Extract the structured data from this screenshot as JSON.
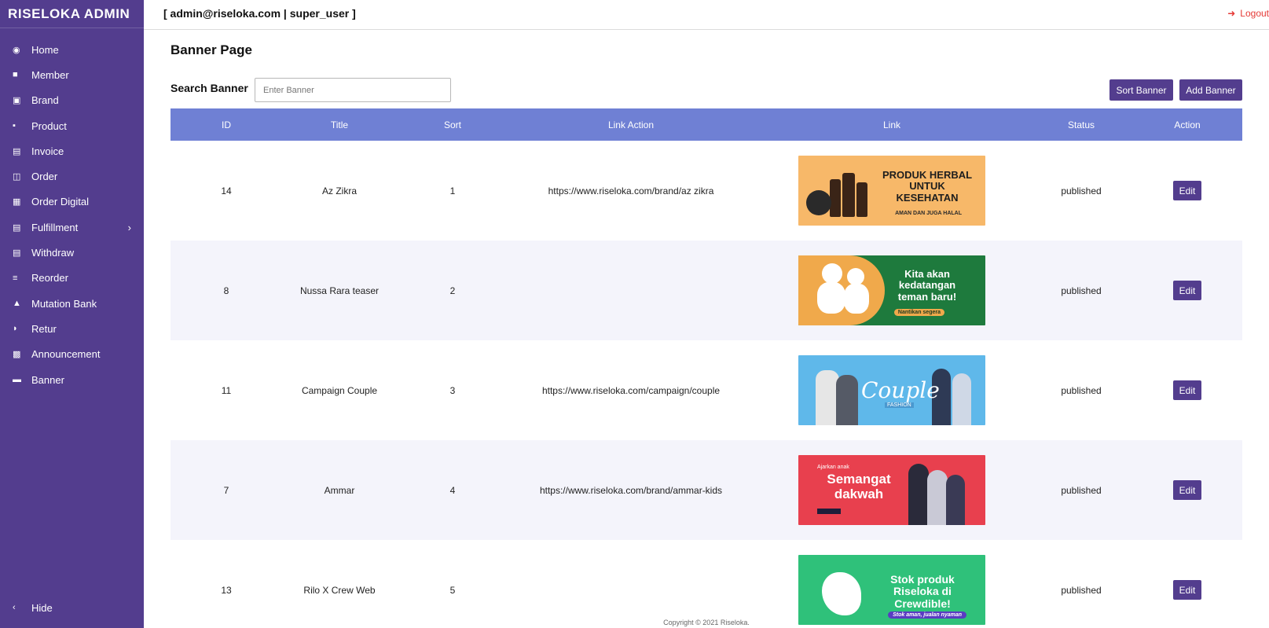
{
  "app": {
    "title": "RISELOKA ADMIN"
  },
  "topbar": {
    "user_info": "[ admin@riseloka.com | super_user ]",
    "logout_label": "Logout"
  },
  "sidebar": {
    "items": [
      {
        "label": "Home",
        "icon": "dashboard-icon"
      },
      {
        "label": "Member",
        "icon": "user-icon"
      },
      {
        "label": "Brand",
        "icon": "brand-icon"
      },
      {
        "label": "Product",
        "icon": "product-icon"
      },
      {
        "label": "Invoice",
        "icon": "invoice-icon"
      },
      {
        "label": "Order",
        "icon": "order-icon"
      },
      {
        "label": "Order Digital",
        "icon": "calendar-icon"
      },
      {
        "label": "Fulfillment",
        "icon": "file-icon",
        "has_submenu": true
      },
      {
        "label": "Withdraw",
        "icon": "file-icon"
      },
      {
        "label": "Reorder",
        "icon": "list-icon"
      },
      {
        "label": "Mutation Bank",
        "icon": "bank-icon"
      },
      {
        "label": "Retur",
        "icon": "return-icon"
      },
      {
        "label": "Announcement",
        "icon": "announcement-icon"
      },
      {
        "label": "Banner",
        "icon": "banner-icon"
      }
    ],
    "hide_label": "Hide"
  },
  "page": {
    "title": "Banner Page",
    "search_label": "Search Banner",
    "search_placeholder": "Enter Banner",
    "sort_button": "Sort Banner",
    "add_button": "Add Banner"
  },
  "table": {
    "columns": [
      "ID",
      "Title",
      "Sort",
      "Link Action",
      "Link",
      "Status",
      "Action"
    ],
    "rows": [
      {
        "id": "14",
        "title": "Az Zikra",
        "sort": "1",
        "link_action": "https://www.riseloka.com/brand/az zikra",
        "status": "published",
        "action": "Edit",
        "banner": {
          "headline": "PRODUK HERBAL UNTUK KESEHATAN",
          "sub": "AMAN DAN JUGA HALAL"
        }
      },
      {
        "id": "8",
        "title": "Nussa Rara teaser",
        "sort": "2",
        "link_action": "",
        "status": "published",
        "action": "Edit",
        "banner": {
          "headline": "Kita akan kedatangan teman baru!",
          "sub": "Nantikan segera"
        }
      },
      {
        "id": "11",
        "title": "Campaign Couple",
        "sort": "3",
        "link_action": "https://www.riseloka.com/campaign/couple",
        "status": "published",
        "action": "Edit",
        "banner": {
          "headline": "Couple",
          "sub": "FASHION"
        }
      },
      {
        "id": "7",
        "title": "Ammar",
        "sort": "4",
        "link_action": "https://www.riseloka.com/brand/ammar-kids",
        "status": "published",
        "action": "Edit",
        "banner": {
          "headline": "Semangat dakwah",
          "sub": "Ajarkan anak"
        }
      },
      {
        "id": "13",
        "title": "Rilo X Crew Web",
        "sort": "5",
        "link_action": "",
        "status": "published",
        "action": "Edit",
        "banner": {
          "headline": "Stok produk Riseloka di Crewdible!",
          "sub": "Stok aman, jualan nyaman"
        }
      }
    ]
  },
  "footer": {
    "text": "Copyright © 2021 Riseloka."
  },
  "colors": {
    "sidebar": "#533d8e",
    "table_header": "#6f80d4",
    "button": "#533d8e",
    "logout": "#e53935"
  }
}
